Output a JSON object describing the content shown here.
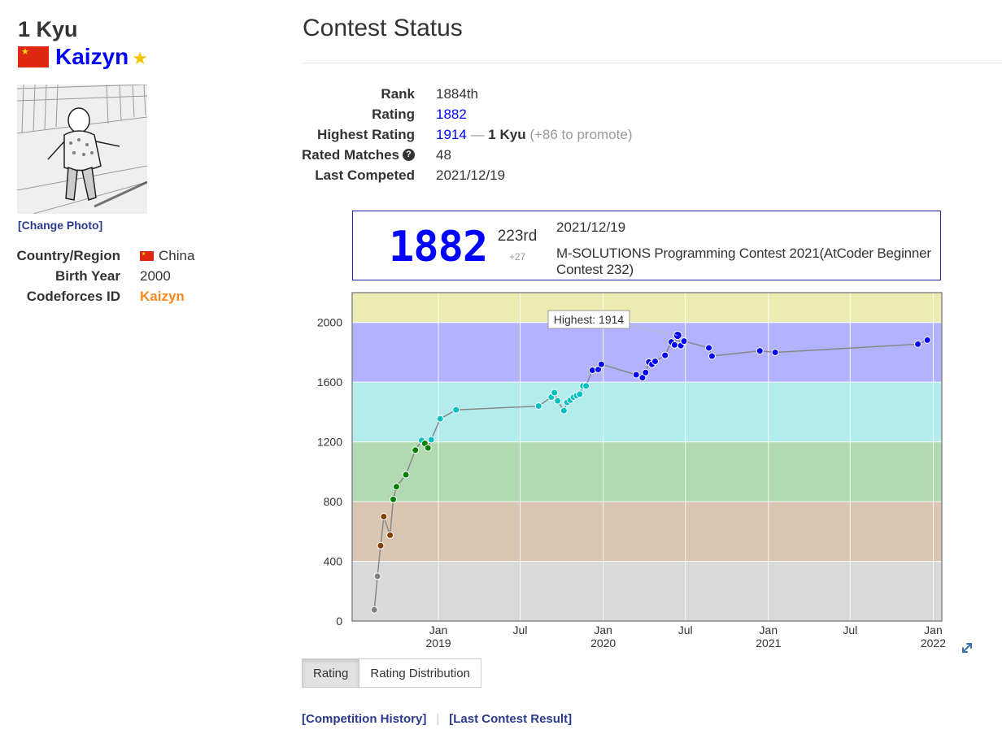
{
  "profile": {
    "kyu": "1 Kyu",
    "name": "Kaizyn",
    "change_photo": "[Change Photo]",
    "info": [
      {
        "key": "Country/Region",
        "value": "China"
      },
      {
        "key": "Birth Year",
        "value": "2000"
      },
      {
        "key": "Codeforces ID",
        "value": "Kaizyn"
      }
    ],
    "colors": {
      "name": "#0000ff",
      "star": "#f5c400",
      "codeforces": "#f7891c"
    }
  },
  "status": {
    "title": "Contest Status",
    "rows": {
      "rank": {
        "key": "Rank",
        "value": "1884th"
      },
      "rating": {
        "key": "Rating",
        "value": "1882"
      },
      "highest": {
        "key": "Highest Rating",
        "value": "1914",
        "dash": "—",
        "kyu": "1 Kyu",
        "promote": "(+86 to promote)"
      },
      "matches": {
        "key": "Rated Matches",
        "value": "48"
      },
      "last": {
        "key": "Last Competed",
        "value": "2021/12/19"
      }
    }
  },
  "latest": {
    "rating": "1882",
    "rank": "223rd",
    "diff": "+27",
    "date": "2021/12/19",
    "contest": "M-SOLUTIONS Programming Contest 2021(AtCoder Beginner Contest 232)"
  },
  "tabs": [
    {
      "label": "Rating",
      "active": true
    },
    {
      "label": "Rating Distribution",
      "active": false
    }
  ],
  "links": {
    "history": "[Competition History]",
    "result": "[Last Contest Result]"
  },
  "chart_data": {
    "type": "line",
    "title": "",
    "xlabel": "",
    "ylabel": "",
    "ylim": [
      0,
      2200
    ],
    "xlim": [
      "2018-06-24",
      "2022-01-20"
    ],
    "yticks": [
      0,
      400,
      800,
      1200,
      1600,
      2000
    ],
    "xticks": [
      {
        "date": "2019-01-01",
        "label": "Jan",
        "year": "2019"
      },
      {
        "date": "2019-07-01",
        "label": "Jul",
        "year": ""
      },
      {
        "date": "2020-01-01",
        "label": "Jan",
        "year": "2020"
      },
      {
        "date": "2020-07-01",
        "label": "Jul",
        "year": ""
      },
      {
        "date": "2021-01-01",
        "label": "Jan",
        "year": "2021"
      },
      {
        "date": "2021-07-01",
        "label": "Jul",
        "year": ""
      },
      {
        "date": "2022-01-01",
        "label": "Jan",
        "year": "2022"
      }
    ],
    "bands": [
      {
        "from": 0,
        "to": 400,
        "color": "#d9d9d9"
      },
      {
        "from": 400,
        "to": 800,
        "color": "#d9c5b2"
      },
      {
        "from": 800,
        "to": 1200,
        "color": "#b2d9b2"
      },
      {
        "from": 1200,
        "to": 1600,
        "color": "#b2ecec"
      },
      {
        "from": 1600,
        "to": 2000,
        "color": "#b2b2ff"
      },
      {
        "from": 2000,
        "to": 2200,
        "color": "#ececb2"
      }
    ],
    "highest_label": "Highest: 1914",
    "series": [
      {
        "values": [
          {
            "x": "2018-08-12",
            "y": 75
          },
          {
            "x": "2018-08-19",
            "y": 300
          },
          {
            "x": "2018-08-26",
            "y": 505
          },
          {
            "x": "2018-09-02",
            "y": 700
          },
          {
            "x": "2018-09-16",
            "y": 575
          },
          {
            "x": "2018-09-23",
            "y": 815
          },
          {
            "x": "2018-09-30",
            "y": 900
          },
          {
            "x": "2018-10-21",
            "y": 980
          },
          {
            "x": "2018-11-11",
            "y": 1145
          },
          {
            "x": "2018-11-25",
            "y": 1210
          },
          {
            "x": "2018-12-02",
            "y": 1190
          },
          {
            "x": "2018-12-09",
            "y": 1160
          },
          {
            "x": "2018-12-16",
            "y": 1215
          },
          {
            "x": "2019-01-05",
            "y": 1355
          },
          {
            "x": "2019-02-09",
            "y": 1415
          },
          {
            "x": "2019-08-11",
            "y": 1440
          },
          {
            "x": "2019-09-08",
            "y": 1500
          },
          {
            "x": "2019-09-15",
            "y": 1530
          },
          {
            "x": "2019-09-22",
            "y": 1475
          },
          {
            "x": "2019-10-06",
            "y": 1410
          },
          {
            "x": "2019-10-13",
            "y": 1465
          },
          {
            "x": "2019-10-20",
            "y": 1480
          },
          {
            "x": "2019-10-27",
            "y": 1500
          },
          {
            "x": "2019-11-03",
            "y": 1510
          },
          {
            "x": "2019-11-10",
            "y": 1520
          },
          {
            "x": "2019-11-17",
            "y": 1575
          },
          {
            "x": "2019-11-24",
            "y": 1575
          },
          {
            "x": "2019-12-08",
            "y": 1680
          },
          {
            "x": "2019-12-21",
            "y": 1685
          },
          {
            "x": "2019-12-28",
            "y": 1720
          },
          {
            "x": "2020-03-14",
            "y": 1650
          },
          {
            "x": "2020-03-28",
            "y": 1630
          },
          {
            "x": "2020-04-04",
            "y": 1665
          },
          {
            "x": "2020-04-11",
            "y": 1735
          },
          {
            "x": "2020-04-18",
            "y": 1720
          },
          {
            "x": "2020-04-25",
            "y": 1740
          },
          {
            "x": "2020-05-17",
            "y": 1780
          },
          {
            "x": "2020-05-31",
            "y": 1870
          },
          {
            "x": "2020-06-07",
            "y": 1850
          },
          {
            "x": "2020-06-14",
            "y": 1914
          },
          {
            "x": "2020-06-21",
            "y": 1845
          },
          {
            "x": "2020-06-28",
            "y": 1875
          },
          {
            "x": "2020-08-22",
            "y": 1830
          },
          {
            "x": "2020-08-29",
            "y": 1775
          },
          {
            "x": "2020-12-13",
            "y": 1810
          },
          {
            "x": "2021-01-16",
            "y": 1800
          },
          {
            "x": "2021-11-28",
            "y": 1855
          },
          {
            "x": "2021-12-19",
            "y": 1882
          }
        ]
      }
    ]
  }
}
